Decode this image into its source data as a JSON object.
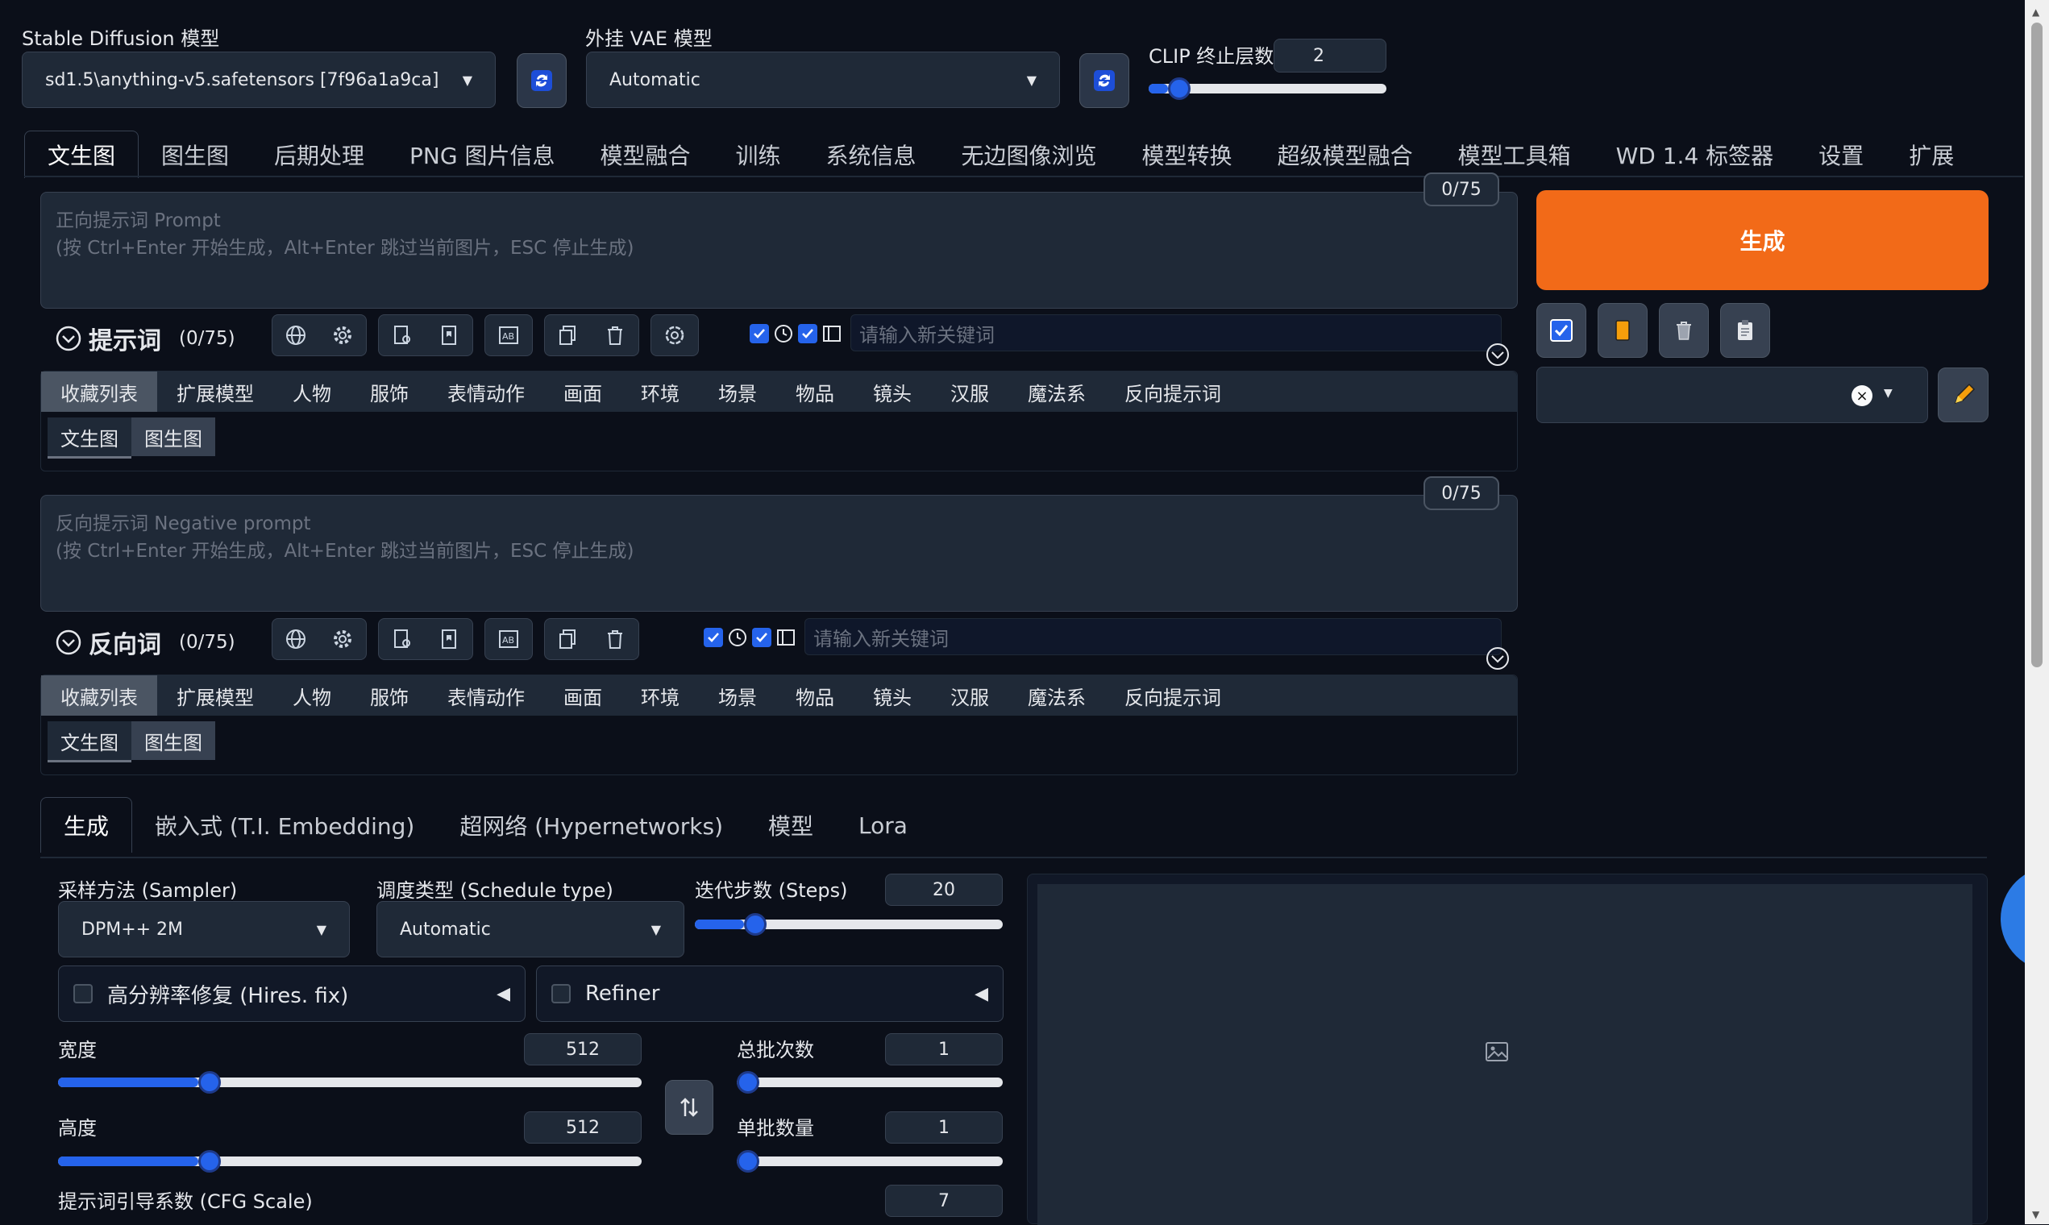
{
  "top": {
    "sd_model_label": "Stable Diffusion 模型",
    "sd_model_value": "sd1.5\\anything-v5.safetensors [7f96a1a9ca]",
    "vae_label": "外挂 VAE 模型",
    "vae_value": "Automatic",
    "clip_label": "CLIP 终止层数",
    "clip_value": "2",
    "clip_level": 0.08
  },
  "main_tabs": [
    "文生图",
    "图生图",
    "后期处理",
    "PNG 图片信息",
    "模型融合",
    "训练",
    "系统信息",
    "无边图像浏览",
    "模型转换",
    "超级模型融合",
    "模型工具箱",
    "WD 1.4 标签器",
    "设置",
    "扩展"
  ],
  "prompt": {
    "placeholder_line1": "正向提示词 Prompt",
    "placeholder_line2": "(按 Ctrl+Enter 开始生成，Alt+Enter 跳过当前图片，ESC 停止生成)",
    "counter": "0/75",
    "section_title": "提示词",
    "section_count": "(0/75)",
    "keyword_placeholder": "请输入新关键词"
  },
  "negative": {
    "placeholder_line1": "反向提示词 Negative prompt",
    "placeholder_line2": "(按 Ctrl+Enter 开始生成，Alt+Enter 跳过当前图片，ESC 停止生成)",
    "counter": "0/75",
    "section_title": "反向词",
    "section_count": "(0/75)",
    "keyword_placeholder": "请输入新关键词"
  },
  "categories": [
    "收藏列表",
    "扩展模型",
    "人物",
    "服饰",
    "表情动作",
    "画面",
    "环境",
    "场景",
    "物品",
    "镜头",
    "汉服",
    "魔法系",
    "反向提示词"
  ],
  "sub_tabs": [
    "文生图",
    "图生图"
  ],
  "generate_label": "生成",
  "params_tabs": [
    "生成",
    "嵌入式 (T.I. Embedding)",
    "超网络 (Hypernetworks)",
    "模型",
    "Lora"
  ],
  "params": {
    "sampler_label": "采样方法 (Sampler)",
    "sampler_value": "DPM++ 2M",
    "schedule_label": "调度类型 (Schedule type)",
    "schedule_value": "Automatic",
    "steps_label": "迭代步数 (Steps)",
    "steps_value": "20",
    "steps_level": 0.16,
    "hires_label": "高分辨率修复 (Hires. fix)",
    "refiner_label": "Refiner",
    "width_label": "宽度",
    "width_value": "512",
    "width_level": 0.24,
    "height_label": "高度",
    "height_value": "512",
    "height_level": 0.24,
    "batch_count_label": "总批次数",
    "batch_count_value": "1",
    "batch_count_level": 0.0,
    "batch_size_label": "单批数量",
    "batch_size_value": "1",
    "batch_size_level": 0.0,
    "cfg_label": "提示词引导系数 (CFG Scale)",
    "cfg_value": "7"
  },
  "colors": {
    "accent": "#2563eb",
    "generate": "#f97316",
    "bg": "#0b0f19"
  }
}
